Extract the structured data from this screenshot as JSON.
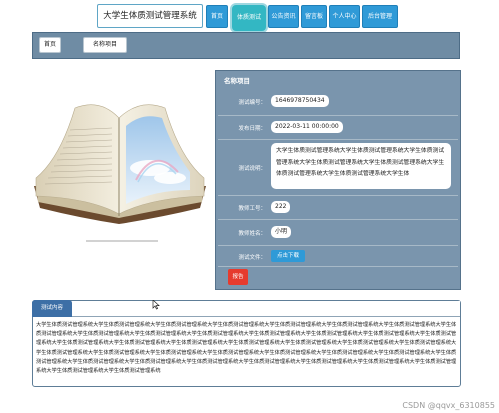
{
  "site": {
    "title": "大学生体质测试管理系统"
  },
  "nav": {
    "items": [
      {
        "label": "首页"
      },
      {
        "label": "体质测试",
        "active": true
      },
      {
        "label": "公告资讯"
      },
      {
        "label": "留言板"
      },
      {
        "label": "个人中心"
      },
      {
        "label": "后台管理"
      }
    ]
  },
  "breadcrumb": {
    "home": "首页",
    "current": "名称项目"
  },
  "detail": {
    "title": "名称项目",
    "fields": {
      "test_no_label": "测试编号：",
      "test_no": "1646978750434",
      "publish_date_label": "发布日期：",
      "publish_date": "2022-03-11 00:00:00",
      "desc_label": "测试说明：",
      "desc": "大学生体质测试管理系统大学生体质测试管理系统大学生体质测试管理系统大学生体质测试管理系统大学生体质测试管理系统大学生体质测试管理系统大学生体质测试管理系统大学生体",
      "teacher_no_label": "教师工号：",
      "teacher_no": "222",
      "teacher_name_label": "教师姓名：",
      "teacher_name": "小明",
      "file_label": "测试文件：",
      "download_label": "点击下载",
      "report_label": "报告"
    }
  },
  "content": {
    "tab_label": "测试内容",
    "text": "大学生体质测试管理系统大学生体质测试管理系统大学生体质测试管理系统大学生体质测试管理系统大学生体质测试管理系统大学生体质测试管理系统大学生体质测试管理系统大学生体质测试管理系统大学生体质测试管理系统大学生体质测试管理系统大学生体质测试管理系统大学生体质测试管理系统大学生体质测试管理系统大学生体质测试管理系统大学生体质测试管理系统大学生体质测试管理系统大学生体质测试管理系统大学生体质测试管理系统大学生体质测试管理系统大学生体质测试管理系统大学生体质测试管理系统大学生体质测试管理系统大学生体质测试管理系统大学生体质测试管理系统大学生体质测试管理系统大学生体质测试管理系统大学生体质测试管理系统大学生体质测试管理系统大学生体质测试管理系统大学生体质测试管理系统大学生体质测试管理系统大学生体质测试管理系统大学生体质测试管理系统大学生体质测试管理系统大学生体质测试管理系统大学生体质测试管理系统大学生体质测试管理系统大学生体质测试管理系统大学生体质测试管理系统"
  },
  "watermark": "CSDN @qqvx_6310855",
  "colors": {
    "nav_blue": "#2f9ad7",
    "nav_active": "#33b7c3",
    "panel": "#7a95ad",
    "report_red": "#e63b2e"
  }
}
